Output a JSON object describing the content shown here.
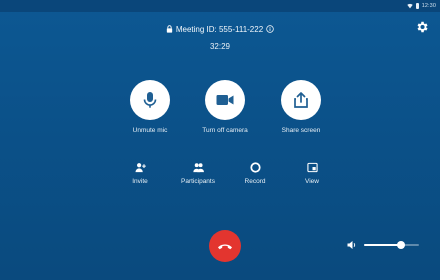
{
  "status_bar": {
    "time": "12:30"
  },
  "header": {
    "meeting_label": "Meeting ID: 555-111-222",
    "timer": "32:29"
  },
  "actions": {
    "mic_label": "Unmute mic",
    "camera_label": "Turn off camera",
    "share_label": "Share screen"
  },
  "tools": {
    "invite_label": "Invite",
    "participants_label": "Participants",
    "record_label": "Record",
    "view_label": "View"
  },
  "volume": {
    "level": 0.68
  },
  "colors": {
    "background": "#0b5189",
    "hangup": "#e3352f",
    "button_bg": "#ffffff",
    "button_icon": "#1f5f93"
  },
  "icons": {
    "settings": "gear-icon",
    "lock": "lock-icon",
    "info": "info-icon",
    "mic": "microphone-icon",
    "camera": "video-camera-icon",
    "share": "share-screen-icon",
    "invite": "add-person-icon",
    "participants": "people-icon",
    "record": "record-icon",
    "view": "view-layout-icon",
    "hangup": "end-call-icon",
    "volume": "speaker-icon"
  }
}
